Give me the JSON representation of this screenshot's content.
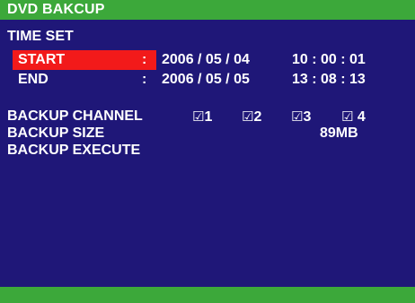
{
  "menu": {
    "title": "DVD BAKCUP",
    "section": "TIME SET"
  },
  "time_set": {
    "start": {
      "label": "START",
      "colon": ":",
      "date": "2006 / 05 / 04",
      "time": "10 : 00 : 01",
      "selected": true
    },
    "end": {
      "label": "END",
      "colon": ":",
      "date": "2006 / 05 / 05",
      "time": "13 : 08 : 13"
    }
  },
  "backup": {
    "channel_label": "BACKUP CHANNEL",
    "channels": [
      {
        "box": "☑",
        "label": "1",
        "checked": true
      },
      {
        "box": "☑",
        "label": "2",
        "checked": true
      },
      {
        "box": "☑",
        "label": "3",
        "checked": true
      },
      {
        "box": "☑",
        "label": " 4",
        "checked": true
      }
    ],
    "size_label": "BACKUP SIZE",
    "size_value": "89MB",
    "execute_label": "BACKUP EXECUTE"
  },
  "colors": {
    "background": "#1f1778",
    "bar": "#3ca83a",
    "highlight": "#f21a1a",
    "text": "#ffffff"
  }
}
